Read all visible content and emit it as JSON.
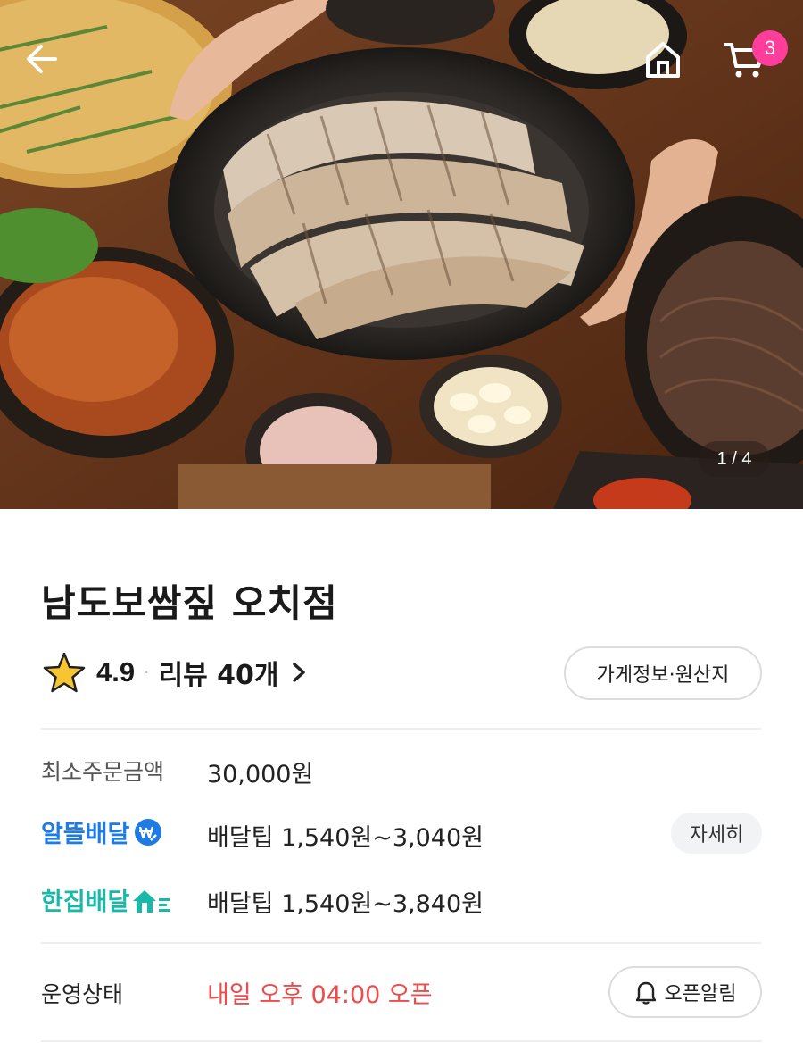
{
  "hero": {
    "pager": "1 / 4",
    "cart_count": "3"
  },
  "store": {
    "name": "남도보쌈짚 오치점",
    "rating": "4.9",
    "separator": "·",
    "reviews": "리뷰 40개",
    "info_button": "가게정보·원산지"
  },
  "order": {
    "min_label": "최소주문금액",
    "min_value": "30,000원"
  },
  "delivery": [
    {
      "brand": "알뜰배달",
      "tip": "배달팁 1,540원~3,040원",
      "detail": "자세히",
      "color": "#1e7be6"
    },
    {
      "brand": "한집배달",
      "tip": "배달팁 1,540원~3,840원",
      "color": "#19b8a8"
    }
  ],
  "status": {
    "label": "운영상태",
    "value": "내일 오후 04:00 오픈",
    "alarm_button": "오픈알림"
  },
  "icons": {
    "back": "back-arrow-icon",
    "home": "home-icon",
    "cart": "cart-icon",
    "star": "star-icon",
    "chevron": "chevron-right-icon",
    "bell": "bell-icon",
    "won": "won-coin-icon",
    "house_speed": "house-speed-icon"
  },
  "colors": {
    "badge": "#ff3d9a",
    "open_status": "#ef4b4b",
    "star": "#f7c531"
  }
}
